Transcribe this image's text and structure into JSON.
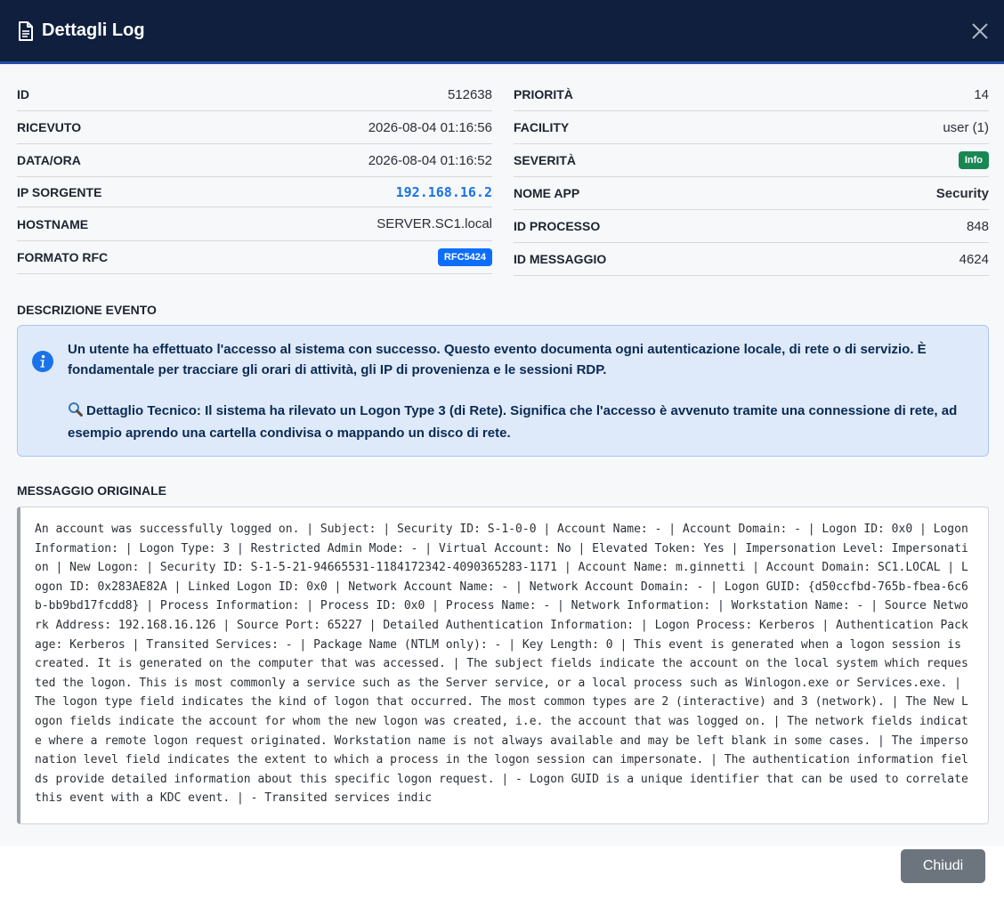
{
  "header": {
    "title": "Dettagli Log"
  },
  "details": {
    "left": [
      {
        "label": "ID",
        "value": "512638"
      },
      {
        "label": "RICEVUTO",
        "value": "2026-08-04 01:16:56"
      },
      {
        "label": "DATA/ORA",
        "value": "2026-08-04 01:16:52"
      },
      {
        "label": "IP SORGENTE",
        "value": "192.168.16.2"
      },
      {
        "label": "HOSTNAME",
        "value": "SERVER.SC1.local"
      },
      {
        "label": "FORMATO RFC",
        "value": "RFC5424"
      }
    ],
    "right": [
      {
        "label": "PRIORITÀ",
        "value": "14"
      },
      {
        "label": "FACILITY",
        "value": "user (1)"
      },
      {
        "label": "SEVERITÀ",
        "value": "Info"
      },
      {
        "label": "NOME APP",
        "value": "Security"
      },
      {
        "label": "ID PROCESSO",
        "value": "848"
      },
      {
        "label": "ID MESSAGGIO",
        "value": "4624"
      }
    ]
  },
  "colors": {
    "header_bg": "#0f1f3d",
    "accent": "#1a73e8",
    "badge_rfc": "#0d6efd",
    "badge_info": "#198754",
    "info_bg": "#deeafa",
    "button": "#6c757d"
  },
  "description": {
    "title": "DESCRIZIONE EVENTO",
    "text": "Un utente ha effettuato l'accesso al sistema con successo. Questo evento documenta ogni autenticazione locale, di rete o di servizio. È fondamentale per tracciare gli orari di attività, gli IP di provenienza e le sessioni RDP.",
    "technical": "Dettaglio Tecnico: Il sistema ha rilevato un Logon Type 3 (di Rete). Significa che l'accesso è avvenuto tramite una connessione di rete, ad esempio aprendo una cartella condivisa o mappando un disco di rete."
  },
  "raw": {
    "title": "MESSAGGIO ORIGINALE",
    "text": "An account was successfully logged on. | Subject: | Security ID: S-1-0-0 | Account Name: - | Account Domain: - | Logon ID: 0x0 | Logon Information: | Logon Type: 3 | Restricted Admin Mode: - | Virtual Account: No | Elevated Token: Yes | Impersonation Level: Impersonation | New Logon: | Security ID: S-1-5-21-94665531-1184172342-4090365283-1171 | Account Name: m.ginnetti | Account Domain: SC1.LOCAL | Logon ID: 0x283AE82A | Linked Logon ID: 0x0 | Network Account Name: - | Network Account Domain: - | Logon GUID: {d50ccfbd-765b-fbea-6c6b-bb9bd17fcdd8} | Process Information: | Process ID: 0x0 | Process Name: - | Network Information: | Workstation Name: - | Source Network Address: 192.168.16.126 | Source Port: 65227 | Detailed Authentication Information: | Logon Process: Kerberos | Authentication Package: Kerberos | Transited Services: - | Package Name (NTLM only): - | Key Length: 0 | This event is generated when a logon session is created. It is generated on the computer that was accessed. | The subject fields indicate the account on the local system which requested the logon. This is most commonly a service such as the Server service, or a local process such as Winlogon.exe or Services.exe. | The logon type field indicates the kind of logon that occurred. The most common types are 2 (interactive) and 3 (network). | The New Logon fields indicate the account for whom the new logon was created, i.e. the account that was logged on. | The network fields indicate where a remote logon request originated. Workstation name is not always available and may be left blank in some cases. | The impersonation level field indicates the extent to which a process in the logon session can impersonate. | The authentication information fields provide detailed information about this specific logon request. | - Logon GUID is a unique identifier that can be used to correlate this event with a KDC event. | - Transited services indic"
  },
  "footer": {
    "close_label": "Chiudi"
  },
  "icons": {
    "header": "document-icon",
    "close": "close-icon",
    "info": "info-circle-icon",
    "technical": "magnifier-icon"
  }
}
